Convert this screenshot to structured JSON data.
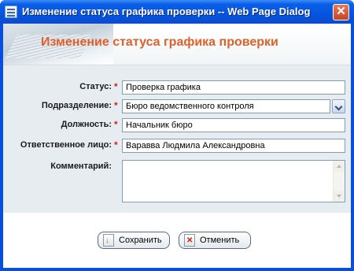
{
  "window": {
    "title": "Изменение статуса графика проверки -- Web Page Dialog",
    "close_label": "✕"
  },
  "header": {
    "title": "Изменение статуса графика проверки"
  },
  "form": {
    "status": {
      "label": "Статус:",
      "required": "*",
      "value": "Проверка графика"
    },
    "department": {
      "label": "Подразделение:",
      "required": "*",
      "selected": "Бюро ведомственного контроля"
    },
    "position": {
      "label": "Должность:",
      "required": "*",
      "value": "Начальник бюро"
    },
    "responsible": {
      "label": "Ответственное лицо:",
      "required": "*",
      "value": "Варавва Людмила Александровна"
    },
    "comment": {
      "label": "Комментарий:",
      "value": ""
    }
  },
  "buttons": {
    "save": {
      "label": "Сохранить",
      "icon": "save-icon"
    },
    "cancel": {
      "label": "Отменить",
      "icon": "cancel-icon"
    }
  },
  "colors": {
    "title_bar": "#0654df",
    "header_title": "#e0602b",
    "form_bg": "#e6ecf0",
    "required": "#e02020"
  }
}
